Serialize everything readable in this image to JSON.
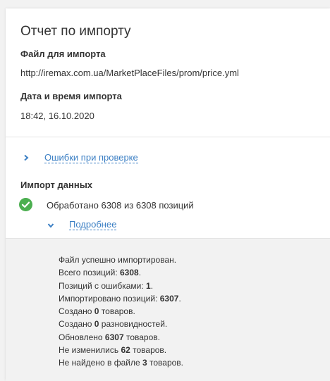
{
  "report": {
    "title": "Отчет по импорту",
    "file_label": "Файл для импорта",
    "file_url": "http://iremax.com.ua/MarketPlaceFiles/prom/price.yml",
    "datetime_label": "Дата и время импорта",
    "datetime_value": "18:42, 16.10.2020"
  },
  "validation": {
    "errors_link": "Ошибки при проверке",
    "icon": "chevron-right-icon"
  },
  "import_data": {
    "heading": "Импорт данных",
    "status_icon": "check-circle-icon",
    "processed_text": "Обработано 6308 из 6308 позиций",
    "details_link": "Подробнее",
    "details_icon": "chevron-down-icon"
  },
  "details": {
    "line1": "Файл успешно импортирован.",
    "total_prefix": "Всего позиций: ",
    "total_value": "6308",
    "total_suffix": ".",
    "errors_prefix": "Позиций с ошибками: ",
    "errors_value": "1",
    "errors_suffix": ".",
    "imported_prefix": "Импортировано позиций: ",
    "imported_value": "6307",
    "imported_suffix": ".",
    "created_prefix": "Создано ",
    "created_value": "0",
    "created_suffix": " товаров.",
    "variants_prefix": "Создано ",
    "variants_value": "0",
    "variants_suffix": " разновидностей.",
    "updated_prefix": "Обновлено ",
    "updated_value": "6307",
    "updated_suffix": " товаров.",
    "unchanged_prefix": "Не изменились ",
    "unchanged_value": "62",
    "unchanged_suffix": " товаров.",
    "notfound_prefix": "Не найдено в файле ",
    "notfound_value": "3",
    "notfound_suffix": " товаров."
  },
  "colors": {
    "link": "#3b7fc4",
    "success": "#4caf50",
    "panel_bg": "#f2f2f2"
  }
}
